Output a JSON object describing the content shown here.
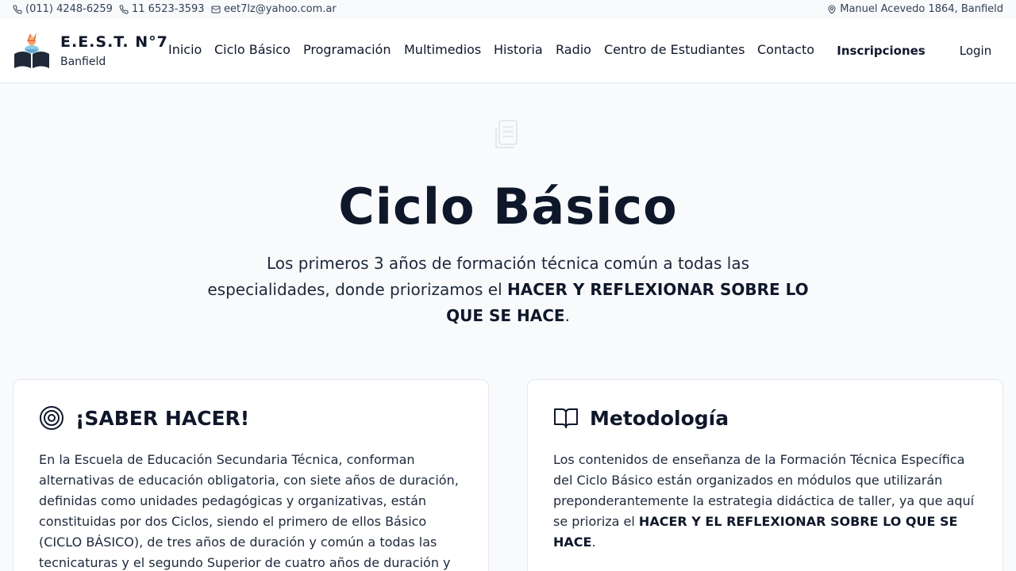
{
  "topbar": {
    "phone1": "(011) 4248-6259",
    "phone2": "11 6523-3593",
    "email": "eet7lz@yahoo.com.ar",
    "address": "Manuel Acevedo 1864, Banfield"
  },
  "header": {
    "brand_name": "E.E.S.T. N°7",
    "brand_sub": "Banfield",
    "nav": [
      "Inicio",
      "Ciclo Básico",
      "Programación",
      "Multimedios",
      "Historia",
      "Radio",
      "Centro de Estudiantes",
      "Contacto"
    ],
    "inscripciones": "Inscripciones",
    "login": "Login"
  },
  "hero": {
    "title": "Ciclo Básico",
    "desc_line1": "Los primeros 3 años de formación técnica común a todas las",
    "desc_line2": "especialidades, donde priorizamos el ",
    "desc_bold": "HACER Y REFLEXIONAR SOBRE LO QUE SE HACE",
    "desc_end": "."
  },
  "cards": {
    "saber": {
      "title": "¡SABER HACER!",
      "body": "En la Escuela de Educación Secundaria Técnica, conforman alternativas de educación obligatoria, con siete años de duración, definidas como unidades pedagógicas y organizativas, están constituidas por dos Ciclos, siendo el primero de ellos Básico (CICLO BÁSICO), de tres años de duración y común a todas las tecnicaturas y el segundo Superior de cuatro años de duración y"
    },
    "metodologia": {
      "title": "Metodología",
      "body": "Los contenidos de enseñanza de la Formación Técnica Específica del Ciclo Básico están organizados en módulos que utilizarán preponderantemente la estrategia didáctica de taller, ya que aquí se prioriza el ",
      "bold": "HACER Y EL REFLEXIONAR SOBRE LO QUE SE HACE",
      "end": "."
    }
  }
}
